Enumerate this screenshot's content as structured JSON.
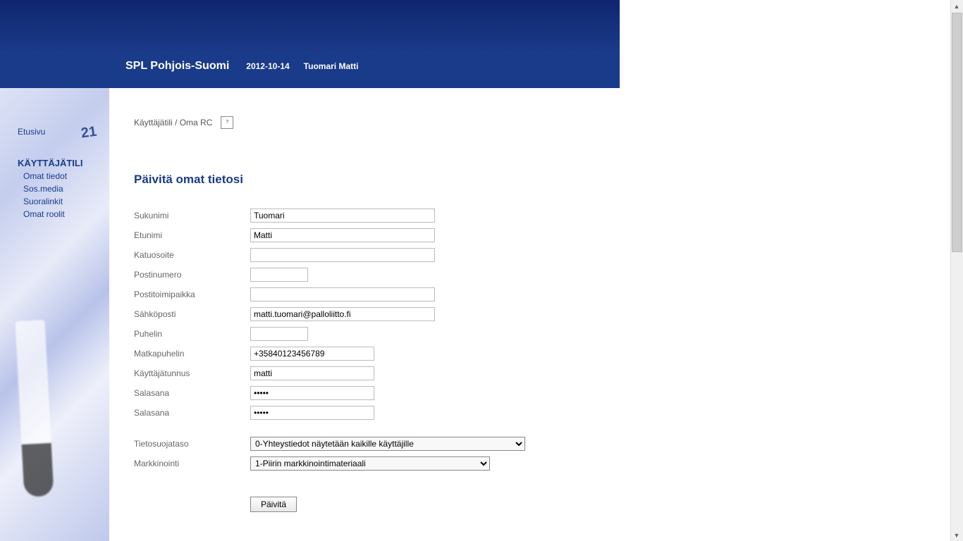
{
  "header": {
    "title": "SPL Pohjois-Suomi",
    "date": "2012-10-14",
    "user": "Tuomari Matti"
  },
  "sidebar": {
    "home": "Etusivu",
    "section_title": "KÄYTTÄJÄTILI",
    "items": [
      {
        "label": "Omat tiedot"
      },
      {
        "label": "Sos.media"
      },
      {
        "label": "Suoralinkit"
      },
      {
        "label": "Omat roolit"
      }
    ]
  },
  "breadcrumb": {
    "text": "Käyttäjätili / Oma RC",
    "help": "?"
  },
  "page_title": "Päivitä omat tietosi",
  "form": {
    "labels": {
      "sukunimi": "Sukunimi",
      "etunimi": "Etunimi",
      "katuosoite": "Katuosoite",
      "postinumero": "Postinumero",
      "postitoimipaikka": "Postitoimipaikka",
      "sahkoposti": "Sähköposti",
      "puhelin": "Puhelin",
      "matkapuhelin": "Matkapuhelin",
      "kayttajatunnus": "Käyttäjätunnus",
      "salasana1": "Salasana",
      "salasana2": "Salasana",
      "tietosuojataso": "Tietosuojataso",
      "markkinointi": "Markkinointi"
    },
    "values": {
      "sukunimi": "Tuomari",
      "etunimi": "Matti",
      "katuosoite": "",
      "postinumero": "",
      "postitoimipaikka": "",
      "sahkoposti": "matti.tuomari@palloliitto.fi",
      "puhelin": "",
      "matkapuhelin": "+35840123456789",
      "kayttajatunnus": "matti",
      "salasana1": "•••••",
      "salasana2": "•••••",
      "tietosuojataso": "0-Yhteystiedot näytetään kaikille käyttäjille",
      "markkinointi": "1-Piirin markkinointimateriaali"
    },
    "submit": "Päivitä"
  }
}
